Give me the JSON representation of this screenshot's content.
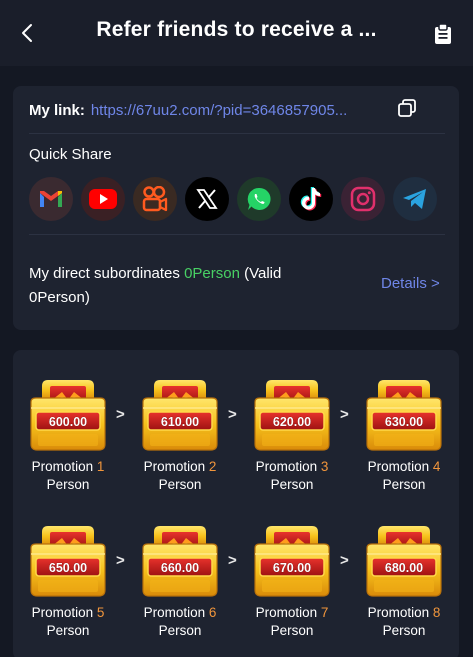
{
  "header": {
    "title": "Refer friends to receive a ..."
  },
  "link": {
    "label": "My link:",
    "url": "https://67uu2.com/?pid=3646857905..."
  },
  "quick_share": {
    "label": "Quick Share",
    "icons": [
      "gmail-icon",
      "youtube-icon",
      "kuaishou-icon",
      "x-icon",
      "whatsapp-icon",
      "tiktok-icon",
      "instagram-icon",
      "telegram-icon"
    ]
  },
  "subordinates": {
    "prefix": "My direct subordinates",
    "count": "0Person",
    "valid_text": "(Valid 0Person)",
    "details_label": "Details >"
  },
  "rewards": [
    {
      "amount": "600.00",
      "promotion_label": "Promotion",
      "number": "1",
      "unit": "Person"
    },
    {
      "amount": "610.00",
      "promotion_label": "Promotion",
      "number": "2",
      "unit": "Person"
    },
    {
      "amount": "620.00",
      "promotion_label": "Promotion",
      "number": "3",
      "unit": "Person"
    },
    {
      "amount": "630.00",
      "promotion_label": "Promotion",
      "number": "4",
      "unit": "Person"
    },
    {
      "amount": "650.00",
      "promotion_label": "Promotion",
      "number": "5",
      "unit": "Person"
    },
    {
      "amount": "660.00",
      "promotion_label": "Promotion",
      "number": "6",
      "unit": "Person"
    },
    {
      "amount": "670.00",
      "promotion_label": "Promotion",
      "number": "7",
      "unit": "Person"
    },
    {
      "amount": "680.00",
      "promotion_label": "Promotion",
      "number": "8",
      "unit": "Person"
    }
  ],
  "arrow_symbol": ">",
  "colors": {
    "background": "#141823",
    "card": "#1e2330",
    "link": "#6f86e8",
    "green": "#48d064",
    "orange": "#f0953c"
  }
}
